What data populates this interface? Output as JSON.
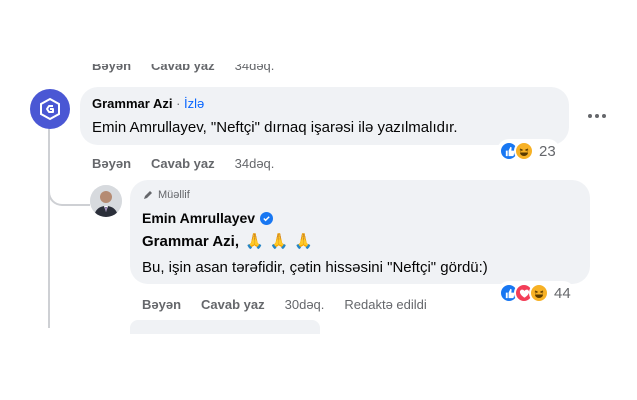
{
  "top_partial": {
    "like": "Bəyən",
    "reply": "Cavab yaz",
    "time": "34dəq."
  },
  "comment1": {
    "author": "Grammar Azi",
    "separator": "·",
    "follow": "İzlə",
    "text": "Emin Amrullayev, \"Neftçi\" dırnaq işarəsi ilə yazılmalıdır.",
    "actions": {
      "like": "Bəyən",
      "reply": "Cavab yaz",
      "time": "34dəq."
    },
    "reactions": {
      "icons": [
        "like-icon",
        "haha-icon"
      ],
      "count": "23"
    }
  },
  "reply1": {
    "badge": "Müəllif",
    "author": "Emin Amrullayev",
    "verified": true,
    "mention": "Grammar Azi,",
    "emoji": [
      "🙏",
      "🙏",
      "🙏"
    ],
    "text": "Bu, işin asan tərəfidir, çətin hissəsini \"Neftçi\" gördü:)",
    "actions": {
      "like": "Bəyən",
      "reply": "Cavab yaz",
      "time": "30dəq.",
      "edited": "Redaktə edildi"
    },
    "reactions": {
      "icons": [
        "like-icon",
        "love-icon",
        "haha-icon"
      ],
      "count": "44"
    }
  },
  "colors": {
    "bubble": "#f0f2f5",
    "secondary_text": "#65676b",
    "link": "#0866ff",
    "like": "#1877f2",
    "love": "#f33e58",
    "haha": "#f7b125",
    "page_avatar": "#4a57d4"
  }
}
